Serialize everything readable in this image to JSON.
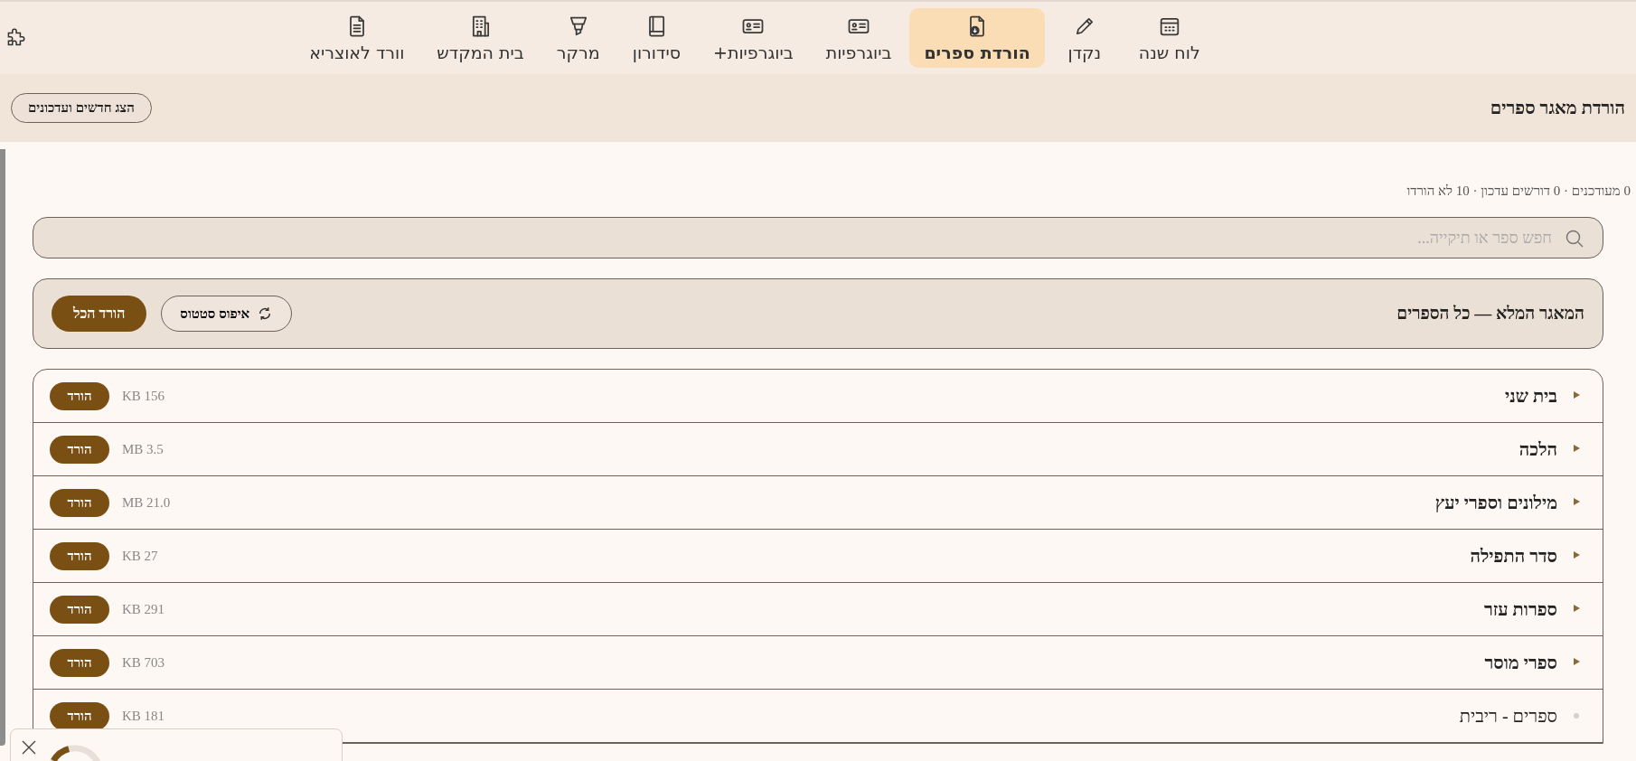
{
  "nav": {
    "tabs": [
      {
        "label": "לוח שנה",
        "selected": false
      },
      {
        "label": "נקדן",
        "selected": false
      },
      {
        "label": "הורדת ספרים",
        "selected": true
      },
      {
        "label": "ביוגרפיות",
        "selected": false
      },
      {
        "label": "ביוגרפיות+",
        "selected": false
      },
      {
        "label": "סידורון",
        "selected": false
      },
      {
        "label": "מרקר",
        "selected": false
      },
      {
        "label": "בית המקדש",
        "selected": false
      },
      {
        "label": "וורד לאוצריא",
        "selected": false
      }
    ]
  },
  "header": {
    "title": "הורדת מאגר ספרים",
    "button": "הצג חדשים ועדכונים"
  },
  "stats": "0 מעודכנים · 0 דורשים עדכון · 10 לא הורדו",
  "search": {
    "placeholder": "חפש ספר או תיקייה..."
  },
  "toolbar": {
    "title": "המאגר המלא — כל הספרים",
    "reset_button": "איפוס סטטוס",
    "download_all_button": "הורד הכל"
  },
  "rows": [
    {
      "kind": "folder",
      "name": "בית שני",
      "size": "156 KB",
      "button": "הורד"
    },
    {
      "kind": "folder",
      "name": "הלכה",
      "size": "3.5 MB",
      "button": "הורד"
    },
    {
      "kind": "folder",
      "name": "מילונים וספרי יעץ",
      "size": "21.0 MB",
      "button": "הורד"
    },
    {
      "kind": "folder",
      "name": "סדר התפילה",
      "size": "27 KB",
      "button": "הורד"
    },
    {
      "kind": "folder",
      "name": "ספרות עזר",
      "size": "291 KB",
      "button": "הורד"
    },
    {
      "kind": "folder",
      "name": "ספרי מוסר",
      "size": "703 KB",
      "button": "הורד"
    },
    {
      "kind": "file",
      "name": "ספרים - ריבית",
      "size": "181 KB",
      "button": "הורד"
    }
  ]
}
